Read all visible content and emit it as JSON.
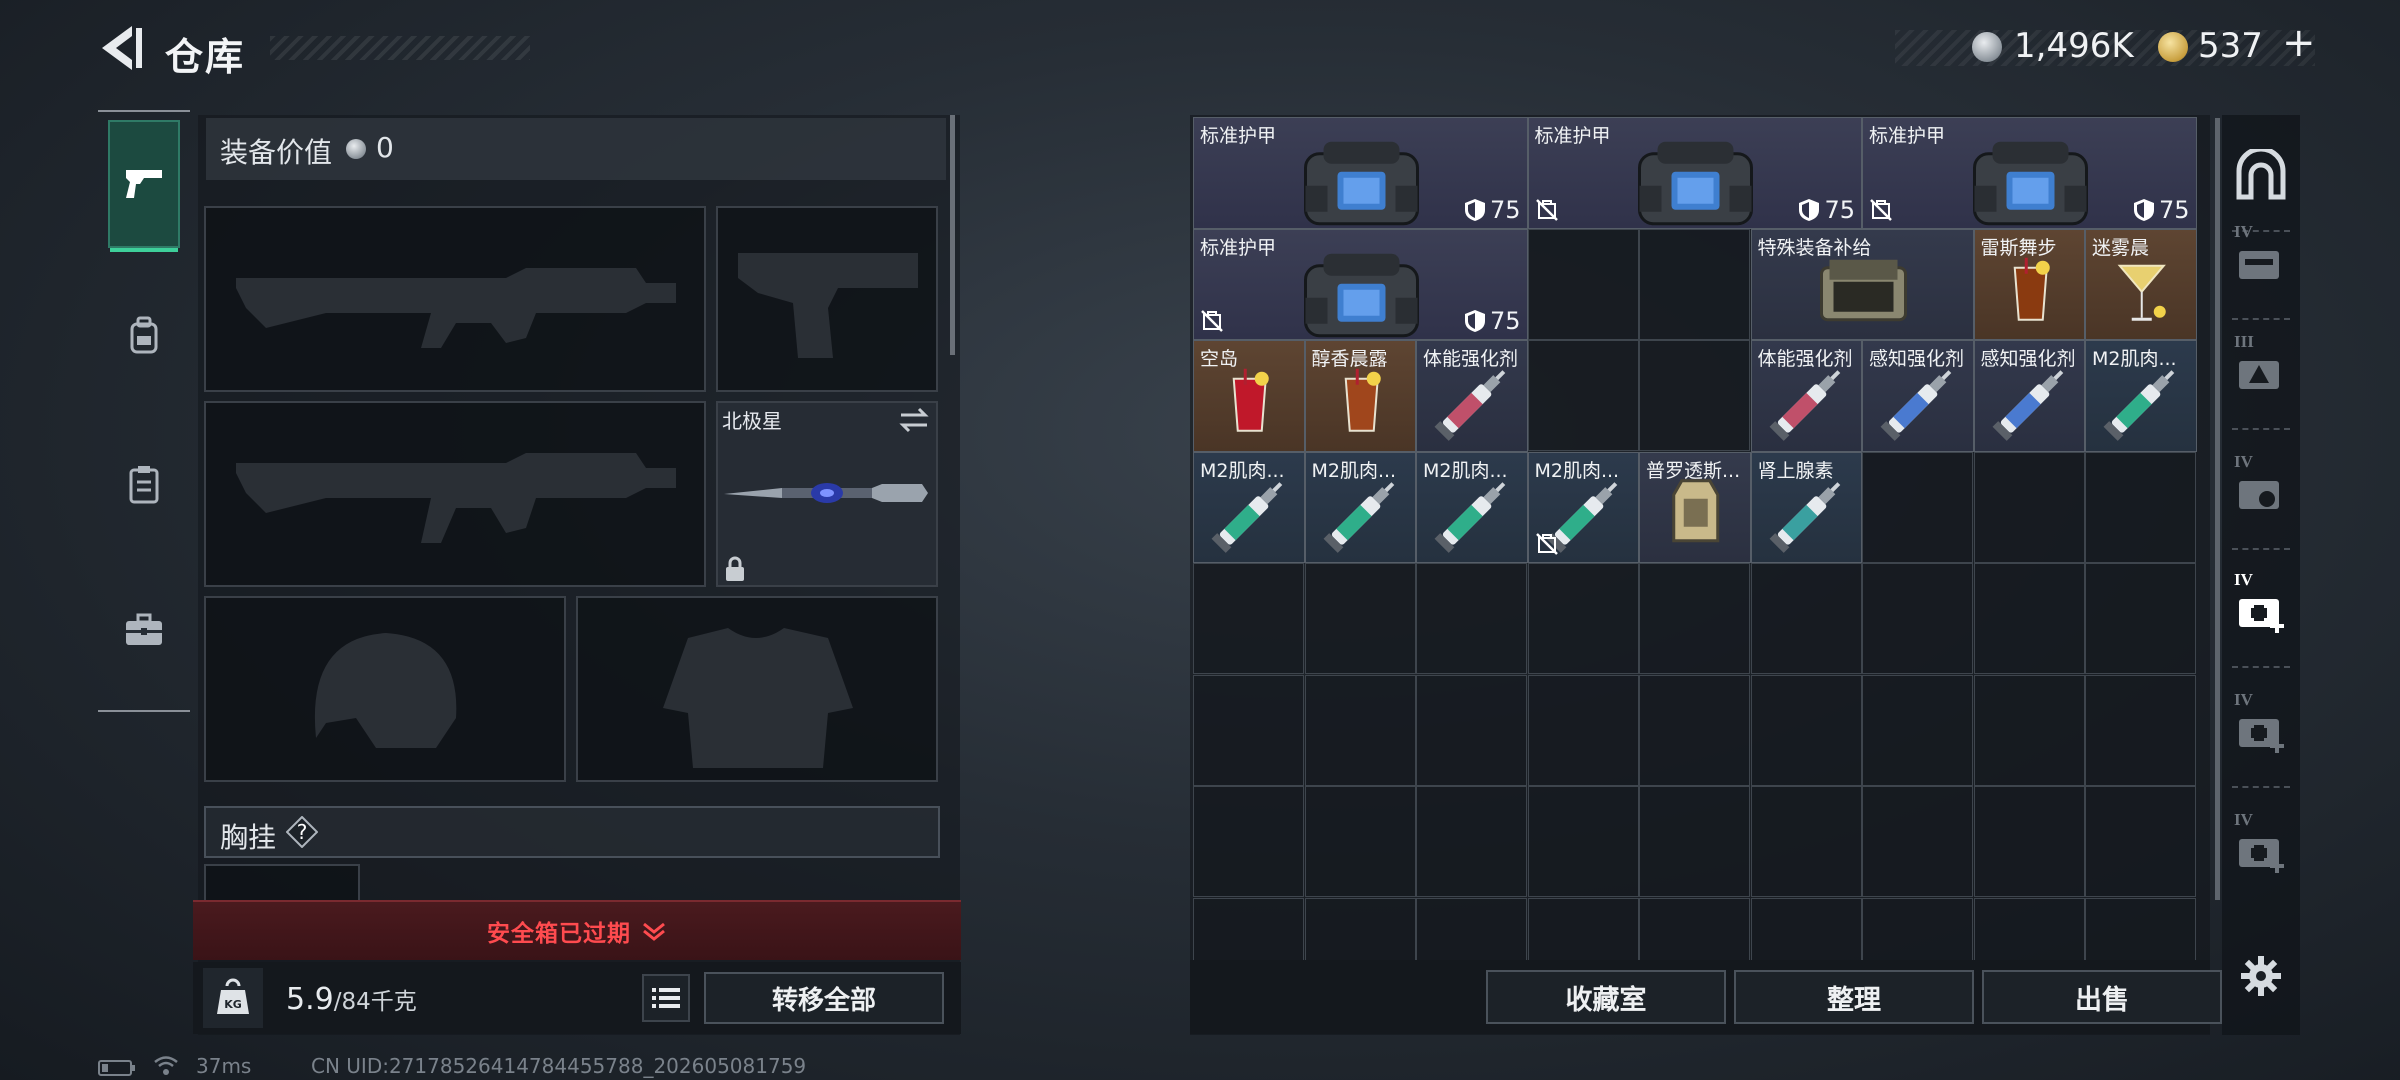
{
  "header": {
    "title": "仓库",
    "silver_value": "1,496K",
    "gold_value": "537",
    "gold_plus": "+"
  },
  "left_nav": {
    "items": [
      {
        "name": "weapon-tab",
        "icon": "pistol-icon",
        "active": true
      },
      {
        "name": "backpack-tab",
        "icon": "backpack-icon",
        "active": false
      },
      {
        "name": "clipboard-tab",
        "icon": "clipboard-icon",
        "active": false
      },
      {
        "name": "case-tab",
        "icon": "briefcase-icon",
        "active": false
      }
    ]
  },
  "equipment": {
    "value_label": "装备价值",
    "value_amount": "0",
    "melee_name": "北极星",
    "chest_rig_label": "胸挂",
    "chest_rig_help": "?",
    "safe_box_text": "安全箱已过期",
    "weight_current": "5.9",
    "weight_max": "/84千克",
    "transfer_all_label": "转移全部"
  },
  "storage": {
    "columns": 9,
    "rows": 8,
    "items": [
      {
        "name": "标准护甲",
        "col": 0,
        "row": 0,
        "w": 3,
        "h": 1,
        "type": "armor",
        "durability": "75",
        "no_carry": false
      },
      {
        "name": "标准护甲",
        "col": 3,
        "row": 0,
        "w": 3,
        "h": 1,
        "type": "armor",
        "durability": "75",
        "no_carry": true
      },
      {
        "name": "标准护甲",
        "col": 6,
        "row": 0,
        "w": 3,
        "h": 1,
        "type": "armor",
        "durability": "75",
        "no_carry": true
      },
      {
        "name": "标准护甲",
        "col": 0,
        "row": 1,
        "w": 3,
        "h": 1,
        "type": "armor",
        "durability": "75",
        "no_carry": true
      },
      {
        "name": "特殊装备补给",
        "col": 5,
        "row": 1,
        "w": 2,
        "h": 1,
        "type": "supply",
        "durability": "",
        "no_carry": false
      },
      {
        "name": "雷斯舞步",
        "col": 7,
        "row": 1,
        "w": 1,
        "h": 1,
        "type": "drink-brown",
        "durability": "",
        "no_carry": false
      },
      {
        "name": "迷雾晨",
        "col": 8,
        "row": 1,
        "w": 1,
        "h": 1,
        "type": "drink-martini",
        "durability": "",
        "no_carry": false
      },
      {
        "name": "空岛",
        "col": 0,
        "row": 2,
        "w": 1,
        "h": 1,
        "type": "drink-red",
        "durability": "",
        "no_carry": false
      },
      {
        "name": "醇香晨露",
        "col": 1,
        "row": 2,
        "w": 1,
        "h": 1,
        "type": "drink-tumbler",
        "durability": "",
        "no_carry": false
      },
      {
        "name": "体能强化剂",
        "col": 2,
        "row": 2,
        "w": 1,
        "h": 1,
        "type": "syringe-red",
        "durability": "",
        "no_carry": false
      },
      {
        "name": "体能强化剂",
        "col": 5,
        "row": 2,
        "w": 1,
        "h": 1,
        "type": "syringe-red",
        "durability": "",
        "no_carry": false
      },
      {
        "name": "感知强化剂",
        "col": 6,
        "row": 2,
        "w": 1,
        "h": 1,
        "type": "syringe-blue",
        "durability": "",
        "no_carry": false
      },
      {
        "name": "感知强化剂",
        "col": 7,
        "row": 2,
        "w": 1,
        "h": 1,
        "type": "syringe-blue",
        "durability": "",
        "no_carry": false
      },
      {
        "name": "M2肌肉...",
        "col": 8,
        "row": 2,
        "w": 1,
        "h": 1,
        "type": "syringe-green",
        "durability": "",
        "no_carry": false
      },
      {
        "name": "M2肌肉...",
        "col": 0,
        "row": 3,
        "w": 1,
        "h": 1,
        "type": "syringe-green",
        "durability": "",
        "no_carry": false
      },
      {
        "name": "M2肌肉...",
        "col": 1,
        "row": 3,
        "w": 1,
        "h": 1,
        "type": "syringe-green",
        "durability": "",
        "no_carry": false
      },
      {
        "name": "M2肌肉...",
        "col": 2,
        "row": 3,
        "w": 1,
        "h": 1,
        "type": "syringe-green",
        "durability": "",
        "no_carry": false
      },
      {
        "name": "M2肌肉...",
        "col": 3,
        "row": 3,
        "w": 1,
        "h": 1,
        "type": "syringe-green",
        "durability": "",
        "no_carry": true
      },
      {
        "name": "普罗透斯...",
        "col": 4,
        "row": 3,
        "w": 1,
        "h": 1,
        "type": "device",
        "durability": "",
        "no_carry": false
      },
      {
        "name": "肾上腺素",
        "col": 5,
        "row": 3,
        "w": 1,
        "h": 1,
        "type": "syringe-teal",
        "durability": "",
        "no_carry": false
      }
    ],
    "buttons": {
      "collection": "收藏室",
      "sort": "整理",
      "sell": "出售"
    }
  },
  "right_nav": {
    "items": [
      {
        "name": "safehouse-tab",
        "icon": "arch-icon",
        "level": ""
      },
      {
        "name": "storage-4-tab",
        "icon": "storage-icon",
        "level": "IV"
      },
      {
        "name": "storage-3-tab",
        "icon": "warning-crate-icon",
        "level": "III"
      },
      {
        "name": "storage-4b-tab",
        "icon": "gear-box-icon",
        "level": "IV"
      },
      {
        "name": "medical-4-tab",
        "icon": "medkit-plus-icon",
        "level": "IV",
        "active": true
      },
      {
        "name": "medical-4b-tab",
        "icon": "medkit-plus-icon",
        "level": "IV"
      },
      {
        "name": "medical-4c-tab",
        "icon": "medkit-plus-icon",
        "level": "IV"
      }
    ]
  },
  "status": {
    "ping": "37ms",
    "uid": "CN UID:2717852641478445578​8_202605081759"
  },
  "colors": {
    "accent": "#3ecf9a",
    "warning": "#ff4b4f",
    "item_armor_bg": "#3a3d52",
    "item_orange_bg": "#5a4230",
    "item_blue_bg": "#2e3a4e",
    "item_teal_bg": "#24404a"
  }
}
